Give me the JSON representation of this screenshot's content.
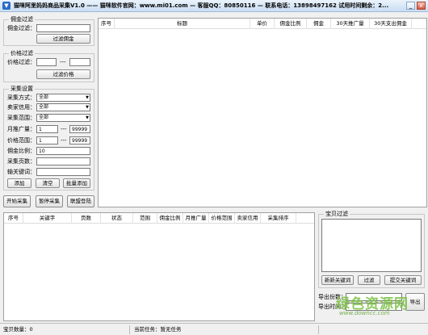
{
  "window": {
    "title": "猫咪阿里妈妈商品采集V1.0  ——  猫咪软件官网：www.mi01.com  —  客服QQ：80850116  —  联系电话：13898497162    试用时间剩余：2...",
    "min_glyph": "_",
    "close_glyph": "x"
  },
  "commission_filter": {
    "legend": "佣金过滤",
    "label": "佣金过滤：",
    "value": "",
    "button": "过滤佣金"
  },
  "price_filter": {
    "legend": "价格过滤",
    "label": "价格过滤：",
    "from": "",
    "sep": "---",
    "to": "",
    "button": "过滤价格"
  },
  "collect_settings": {
    "legend": "采集设置",
    "method_label": "采集方式：",
    "method_value": "全部",
    "seller_label": "卖家信用：",
    "seller_value": "全部",
    "range_label": "采集范围：",
    "range_value": "全部",
    "monthly_label": "月推广量：",
    "monthly_from": "1",
    "monthly_sep": "---",
    "monthly_to": "99999",
    "price_label": "价格范围：",
    "price_from": "1",
    "price_sep": "---",
    "price_to": "99999",
    "ratio_label": "佣金比例：",
    "ratio_value": "10",
    "pages_label": "采集页数：",
    "pages_value": "",
    "keyword_label": "输关键词：",
    "keyword_value": "",
    "add_btn": "添加",
    "clear_btn": "清空",
    "batch_btn": "批量添加"
  },
  "actions": {
    "start": "开始采集",
    "pause": "暂停采集",
    "promote": "联盟登陆"
  },
  "goods_table": {
    "columns": [
      "序号",
      "标题",
      "单价",
      "佣金比例",
      "佣金",
      "30天推广量",
      "30天支出佣金"
    ]
  },
  "task_table": {
    "columns": [
      "序号",
      "关键字",
      "页数",
      "状态",
      "范围",
      "佣金比例",
      "月推广量",
      "价格范围",
      "卖家信用",
      "采集排序"
    ]
  },
  "item_filter": {
    "legend": "宝贝过滤",
    "value": "",
    "new_kw_btn": "新新关键词",
    "filter_btn": "过滤",
    "submit_btn": "提交关键词"
  },
  "export": {
    "count_label": "导出份数：",
    "time_label": "导出时间：",
    "export_btn": "导出"
  },
  "status": {
    "items": "宝贝数量：0",
    "task": "当前任务：暂无任务"
  },
  "watermark": {
    "main": "绿色资源网",
    "sub": "www.downcc.com"
  }
}
